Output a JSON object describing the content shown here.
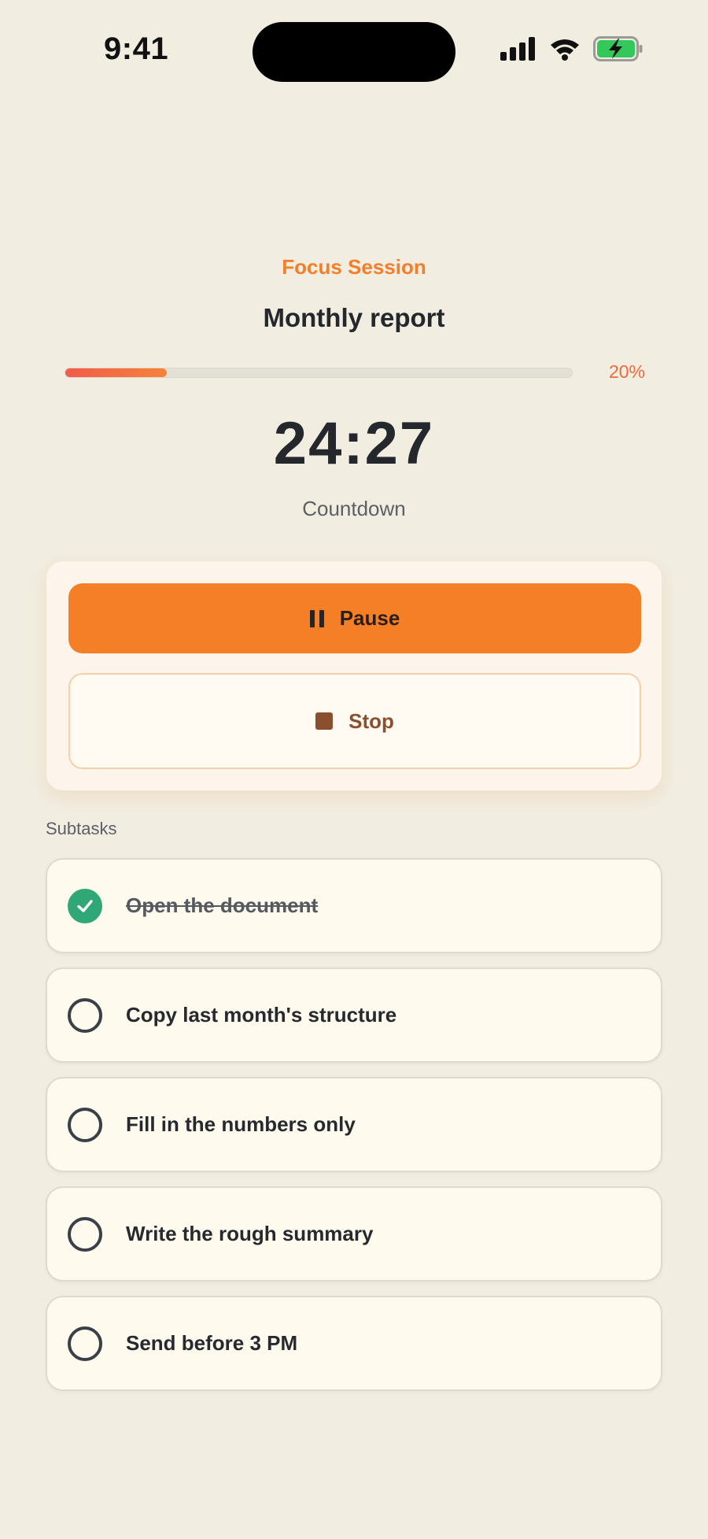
{
  "status_bar": {
    "time": "9:41",
    "icons": [
      "signal-icon",
      "wifi-icon",
      "battery-charging-icon"
    ]
  },
  "session": {
    "label": "Focus Session",
    "task_title": "Monthly report",
    "progress_fraction": 0.2,
    "progress_text": "20%",
    "timer": "24:27",
    "timer_mode": "Countdown"
  },
  "controls": {
    "pause_label": "Pause",
    "stop_label": "Stop"
  },
  "subtasks": {
    "heading": "Subtasks",
    "items": [
      {
        "label": "Open the document",
        "done": true
      },
      {
        "label": "Copy last month's structure",
        "done": false
      },
      {
        "label": "Fill in the numbers only",
        "done": false
      },
      {
        "label": "Write the rough summary",
        "done": false
      },
      {
        "label": "Send before 3 PM",
        "done": false
      }
    ]
  },
  "colors": {
    "background": "#f1ede0",
    "accent": "#f47f26",
    "progress_start": "#f25b4b",
    "check_done": "#2fa777",
    "stop_brown": "#8a4f2c",
    "battery_green": "#34c759"
  }
}
